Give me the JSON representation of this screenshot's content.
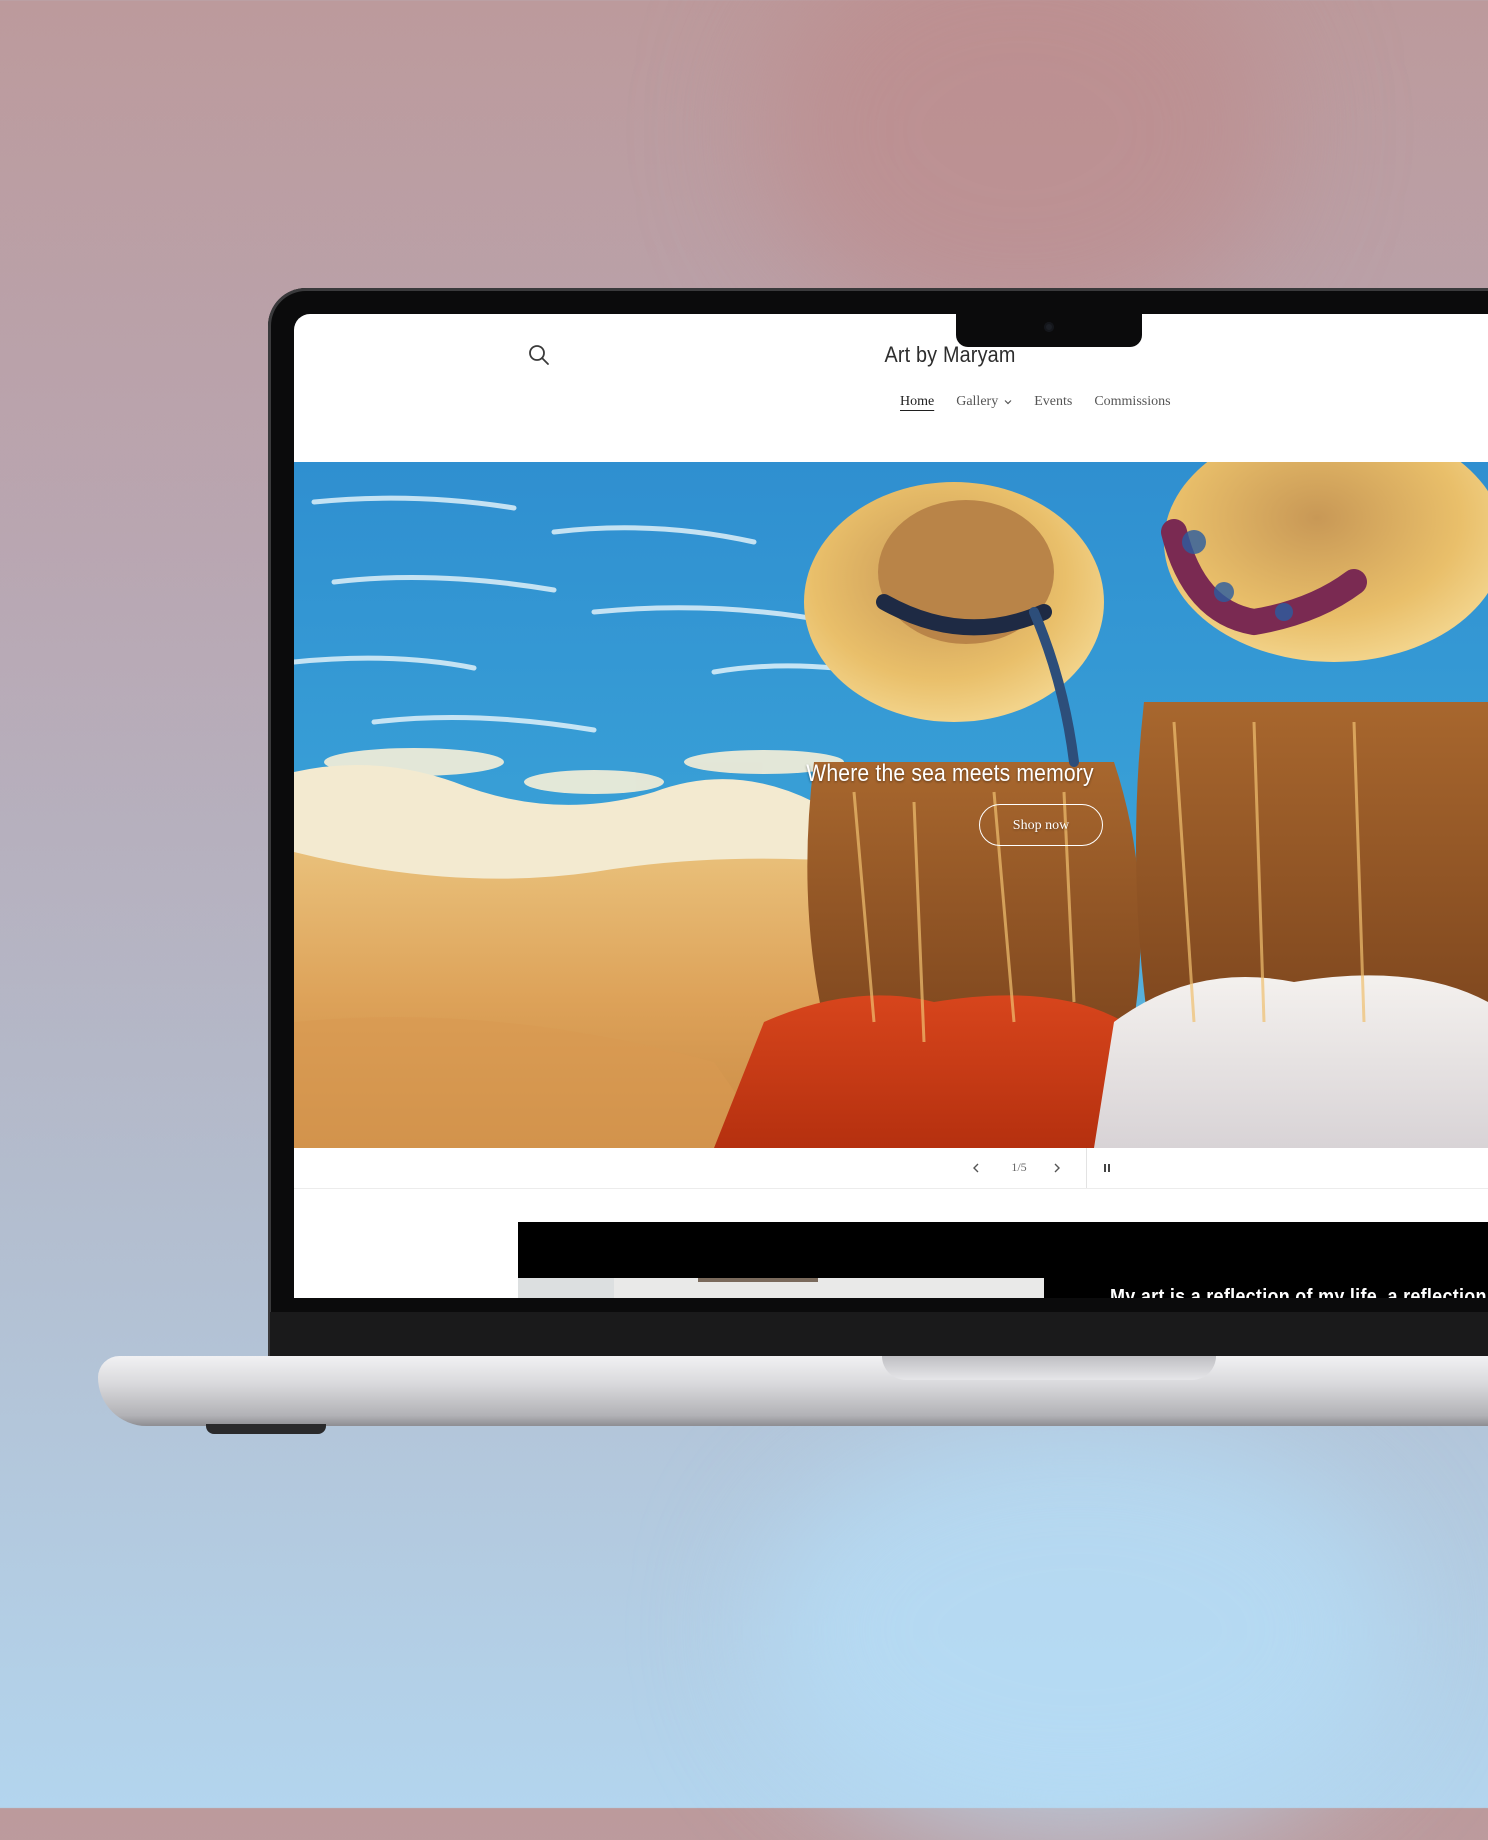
{
  "site": {
    "title": "Art by Maryam"
  },
  "nav": {
    "items": [
      {
        "label": "Home",
        "active": true
      },
      {
        "label": "Gallery",
        "dropdown": true
      },
      {
        "label": "Events"
      },
      {
        "label": "Commissions"
      }
    ]
  },
  "hero": {
    "heading": "Where the sea meets memory",
    "button_label": "Shop now"
  },
  "slider": {
    "counter": "1/5"
  },
  "feature": {
    "text": "My art is a reflection of my life, a reflection"
  },
  "icons": {
    "search": "search-icon",
    "chevron": "chevron-down-icon",
    "prev": "chevron-left-icon",
    "next": "chevron-right-icon",
    "pause": "pause-icon"
  },
  "colors": {
    "page_text": "#2d2d2d",
    "nav_text": "#555555",
    "feature_bg": "#000000"
  }
}
